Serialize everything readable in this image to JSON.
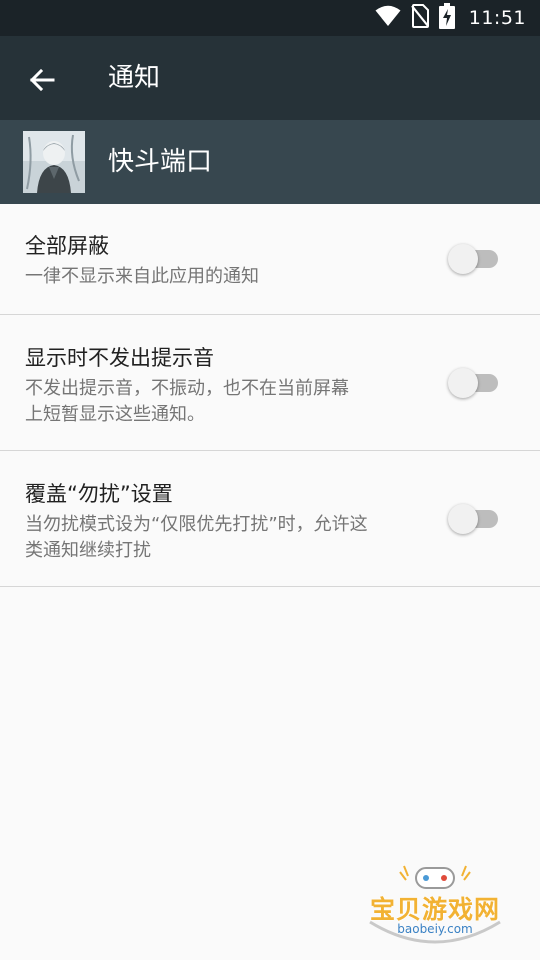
{
  "status_bar": {
    "time": "11:51",
    "icons": [
      "wifi-icon",
      "no-sim-icon",
      "battery-charging-icon"
    ]
  },
  "toolbar": {
    "back_icon": "arrow-back-icon",
    "title": "通知"
  },
  "app_header": {
    "app_name": "快斗端口"
  },
  "settings": [
    {
      "title": "全部屏蔽",
      "desc_lines": [
        "一律不显示来自此应用的通知"
      ],
      "enabled": false
    },
    {
      "title": "显示时不发出提示音",
      "desc_lines": [
        "不发出提示音，不振动，也不在当前屏幕",
        "上短暂显示这些通知。"
      ],
      "enabled": false
    },
    {
      "title": "覆盖“勿扰”设置",
      "desc_lines": [
        "当勿扰模式设为“仅限优先打扰”时，允许这",
        "类通知继续打扰"
      ],
      "enabled": false
    }
  ],
  "watermark": {
    "text": "宝贝游戏网",
    "url": "baobeiy.com"
  },
  "colors": {
    "status_bar": "#1b2328",
    "toolbar": "#263238",
    "app_header": "#37474f",
    "background": "#fafafa",
    "switch_off_track": "#bdbdbd",
    "switch_off_thumb": "#f1f1f1"
  }
}
